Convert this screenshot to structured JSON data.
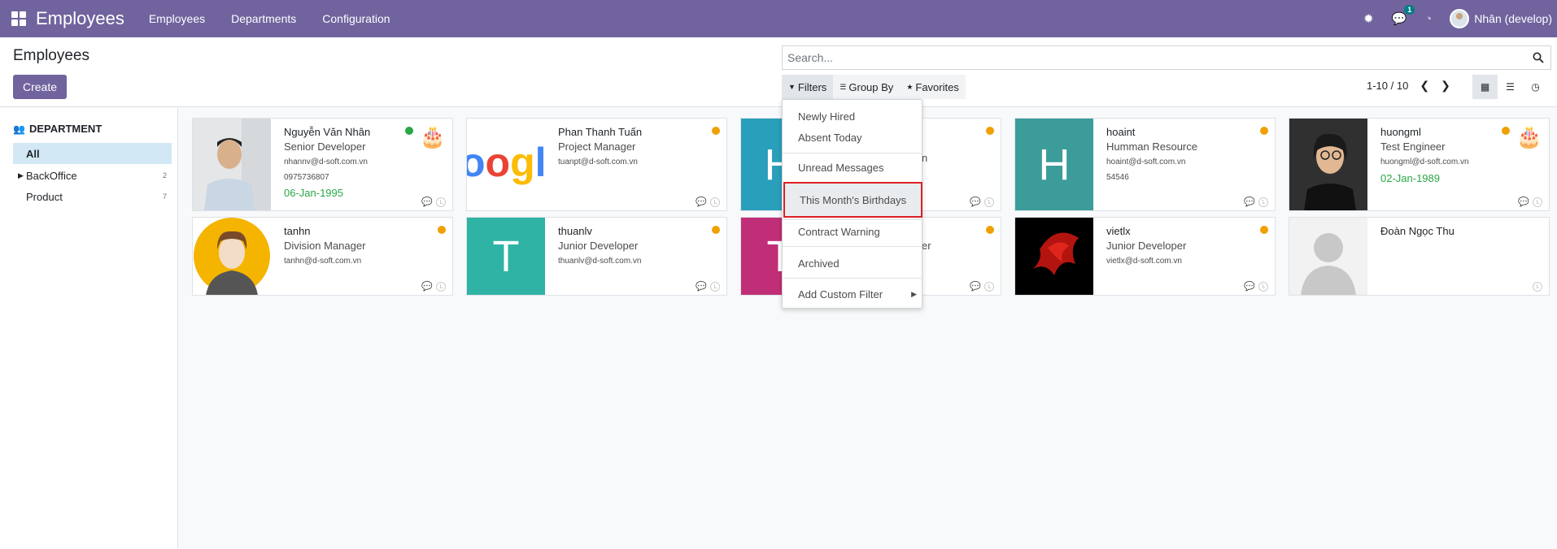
{
  "navbar": {
    "app_name": "Employees",
    "menus": [
      "Employees",
      "Departments",
      "Configuration"
    ],
    "messages_badge": "1",
    "user_name": "Nhân (develop)"
  },
  "control": {
    "title": "Employees",
    "create_label": "Create",
    "search_placeholder": "Search...",
    "filters_label": "Filters",
    "groupby_label": "Group By",
    "favorites_label": "Favorites",
    "pager": "1-10 / 10"
  },
  "side_panel": {
    "title": "DEPARTMENT",
    "items": [
      {
        "label": "All",
        "count": ""
      },
      {
        "label": "BackOffice",
        "count": "2"
      },
      {
        "label": "Product",
        "count": "7"
      }
    ]
  },
  "filters_menu": {
    "items": [
      "Newly Hired",
      "Absent Today",
      "Unread Messages",
      "This Month's Birthdays",
      "Contract Warning",
      "Archived",
      "Add Custom Filter"
    ],
    "highlighted": "This Month's Birthdays"
  },
  "employees": [
    {
      "name": "Nguyễn Văn Nhân",
      "job": "Senior Developer",
      "email": "nhannv@d-soft.com.vn",
      "phone": "0975736807",
      "birthday": "06-Jan-1995",
      "status": "#28a745"
    },
    {
      "name": "Phan Thanh Tuấn",
      "job": "Project Manager",
      "email": "tuanpt@d-soft.com.vn",
      "phone": "",
      "birthday": "",
      "status": "#f0a000"
    },
    {
      "name": "",
      "job": "",
      "email": "",
      "phone": "",
      "birthday": "",
      "status": "#f0a000",
      "letter": "H"
    },
    {
      "name": "hoaint",
      "job": "Humman Resource",
      "email": "hoaint@d-soft.com.vn",
      "phone": "54546",
      "birthday": "",
      "status": "#f0a000",
      "letter": "H"
    },
    {
      "name": "huongml",
      "job": "Test Engineer",
      "email": "huongml@d-soft.com.vn",
      "phone": "",
      "birthday": "02-Jan-1989",
      "status": "#f0a000"
    },
    {
      "name": "tanhn",
      "job": "Division Manager",
      "email": "tanhn@d-soft.com.vn",
      "phone": "",
      "birthday": "",
      "status": "#f0a000"
    },
    {
      "name": "thuanlv",
      "job": "Junior Developer",
      "email": "thuanlv@d-soft.com.vn",
      "phone": "",
      "birthday": "",
      "status": "#f0a000",
      "letter": "T"
    },
    {
      "name": "",
      "job": "er",
      "email": "",
      "phone": "",
      "birthday": "",
      "status": "#f0a000",
      "letter": "T"
    },
    {
      "name": "vietlx",
      "job": "Junior Developer",
      "email": "vietlx@d-soft.com.vn",
      "phone": "",
      "birthday": "",
      "status": "#f0a000"
    },
    {
      "name": "Đoàn Ngọc Thu",
      "job": "",
      "email": "",
      "phone": "",
      "birthday": "",
      "status": ""
    }
  ],
  "icons": {
    "apps": "grid-icon",
    "bug": "bug-icon",
    "chat": "chat-icon",
    "clock": "clock-icon",
    "search": "search-icon",
    "kanban": "kanban-icon",
    "list": "list-icon",
    "activity": "activity-icon",
    "cake": "cake-icon",
    "message": "message-icon"
  },
  "colors": {
    "brand": "#71639e",
    "status_online": "#28a745",
    "status_away": "#f0a000",
    "tile_teal_blue": "#2a9fbb",
    "tile_teal": "#3c9c9a",
    "tile_green": "#2fb3a4",
    "tile_magenta": "#c02e77",
    "highlight_border": "#dc1f26"
  }
}
